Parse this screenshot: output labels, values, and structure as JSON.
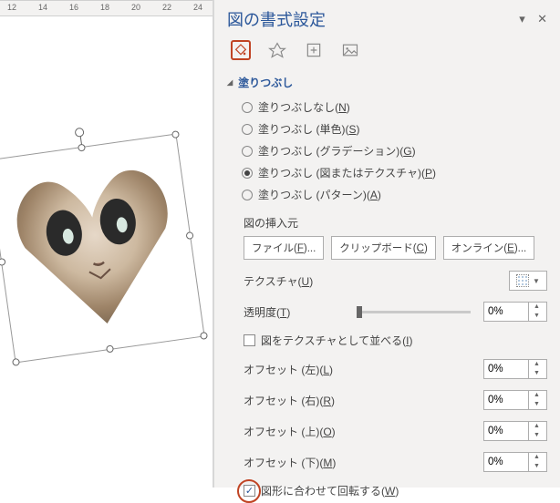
{
  "ruler": {
    "marks": [
      12,
      14,
      16,
      18,
      20,
      22,
      24
    ]
  },
  "panel": {
    "title": "図の書式設定",
    "section_fill": "塗りつぶし",
    "radios": {
      "none": "塗りつぶしなし",
      "none_k": "N",
      "solid": "塗りつぶし (単色)",
      "solid_k": "S",
      "grad": "塗りつぶし (グラデーション)",
      "grad_k": "G",
      "pic": "塗りつぶし (図またはテクスチャ)",
      "pic_k": "P",
      "pat": "塗りつぶし (パターン)",
      "pat_k": "A"
    },
    "insert_label": "図の挿入元",
    "btn_file": "ファイル",
    "btn_file_k": "F",
    "btn_clip": "クリップボード",
    "btn_clip_k": "C",
    "btn_online": "オンライン",
    "btn_online_k": "E",
    "texture_label": "テクスチャ",
    "texture_k": "U",
    "trans_label": "透明度",
    "trans_k": "T",
    "trans_val": "0%",
    "tile_label": "図をテクスチャとして並べる",
    "tile_k": "I",
    "off_left": "オフセット (左)",
    "off_left_k": "L",
    "off_left_v": "0%",
    "off_right": "オフセット (右)",
    "off_right_k": "R",
    "off_right_v": "0%",
    "off_top": "オフセット (上)",
    "off_top_k": "O",
    "off_top_v": "0%",
    "off_bottom": "オフセット (下)",
    "off_bottom_k": "M",
    "off_bottom_v": "0%",
    "rotate_label": "図形に合わせて回転する",
    "rotate_k": "W"
  }
}
